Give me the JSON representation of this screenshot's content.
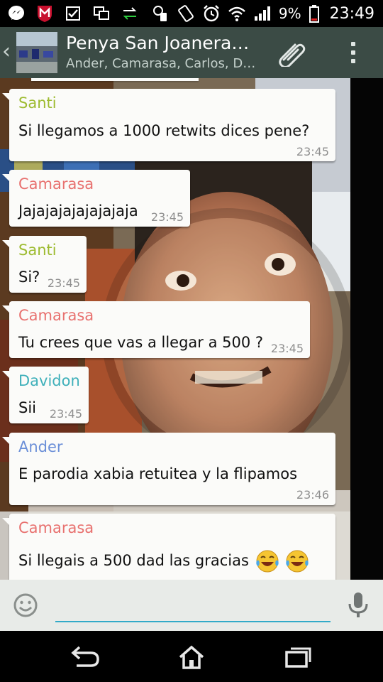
{
  "status_bar": {
    "battery_percent": "9%",
    "time": "23:49",
    "left_icons": [
      "messenger-icon",
      "mcafee-icon",
      "checkbox-icon",
      "windows-icon",
      "transfer-icon"
    ],
    "right_icons": [
      "vibrate-icon",
      "screen-rotate-icon",
      "alarm-icon",
      "wifi-icon",
      "signal-icon",
      "battery-icon"
    ]
  },
  "action_bar": {
    "title": "Penya San Joanera…",
    "subtitle": "Ander, Camarasa, Carlos, D…",
    "back_glyph": "‹"
  },
  "messages": [
    {
      "sender": "Santi",
      "text": "Si llegamos a 1000 retwits dices pene?",
      "time": "23:45"
    },
    {
      "sender": "Camarasa",
      "text": "Jajajajajajajajaja",
      "time": "23:45"
    },
    {
      "sender": "Santi",
      "text": "Si?",
      "time": "23:45"
    },
    {
      "sender": "Camarasa",
      "text": "Tu crees que vas a llegar a 500 ?",
      "time": "23:45"
    },
    {
      "sender": "Davidon",
      "text": "Sii",
      "time": "23:45"
    },
    {
      "sender": "Ander",
      "text": "E parodia xabia retuitea y la flipamos",
      "time": "23:46"
    },
    {
      "sender": "Camarasa",
      "text": "Si llegais a 500 dad las gracias",
      "time": ""
    }
  ],
  "sender_colors": {
    "Santi": "#9dbb30",
    "Camarasa": "#e8716f",
    "Davidon": "#3fb0ba",
    "Ander": "#6b8fd8"
  },
  "input_bar": {
    "placeholder": "",
    "value": ""
  },
  "nav_bar": {
    "buttons": [
      "back-icon",
      "home-icon",
      "recent-apps-icon"
    ]
  }
}
